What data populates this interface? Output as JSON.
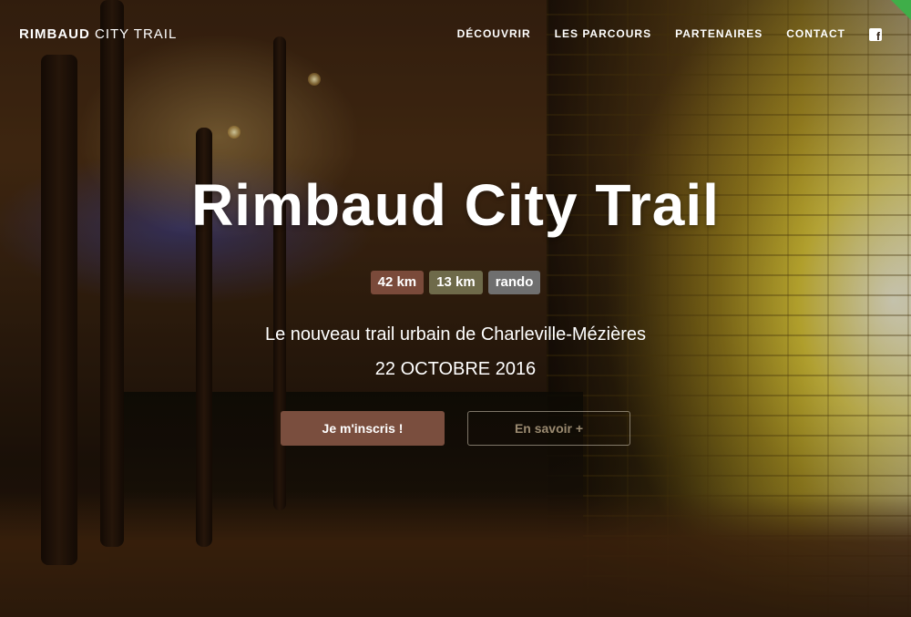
{
  "nav": {
    "brand_bold": "RIMBAUD",
    "brand_rest": " CITY TRAIL",
    "items": [
      {
        "label": "DÉCOUVRIR"
      },
      {
        "label": "LES PARCOURS"
      },
      {
        "label": "PARTENAIRES"
      },
      {
        "label": "CONTACT"
      }
    ],
    "social_icon": "facebook-icon"
  },
  "hero": {
    "title": "Rimbaud City Trail",
    "badges": [
      {
        "label": "42 km",
        "color": "#7a4a3a"
      },
      {
        "label": "13 km",
        "color": "#6e6a4a"
      },
      {
        "label": "rando",
        "color": "#6f6f6f"
      }
    ],
    "subtitle": "Le nouveau trail urbain de Charleville-Mézières",
    "date": "22 OCTOBRE 2016",
    "primary_button": "Je m'inscris !",
    "secondary_button": "En savoir +"
  },
  "colors": {
    "primary_button": "#7a4e3e",
    "accent_corner": "#3fae49"
  }
}
